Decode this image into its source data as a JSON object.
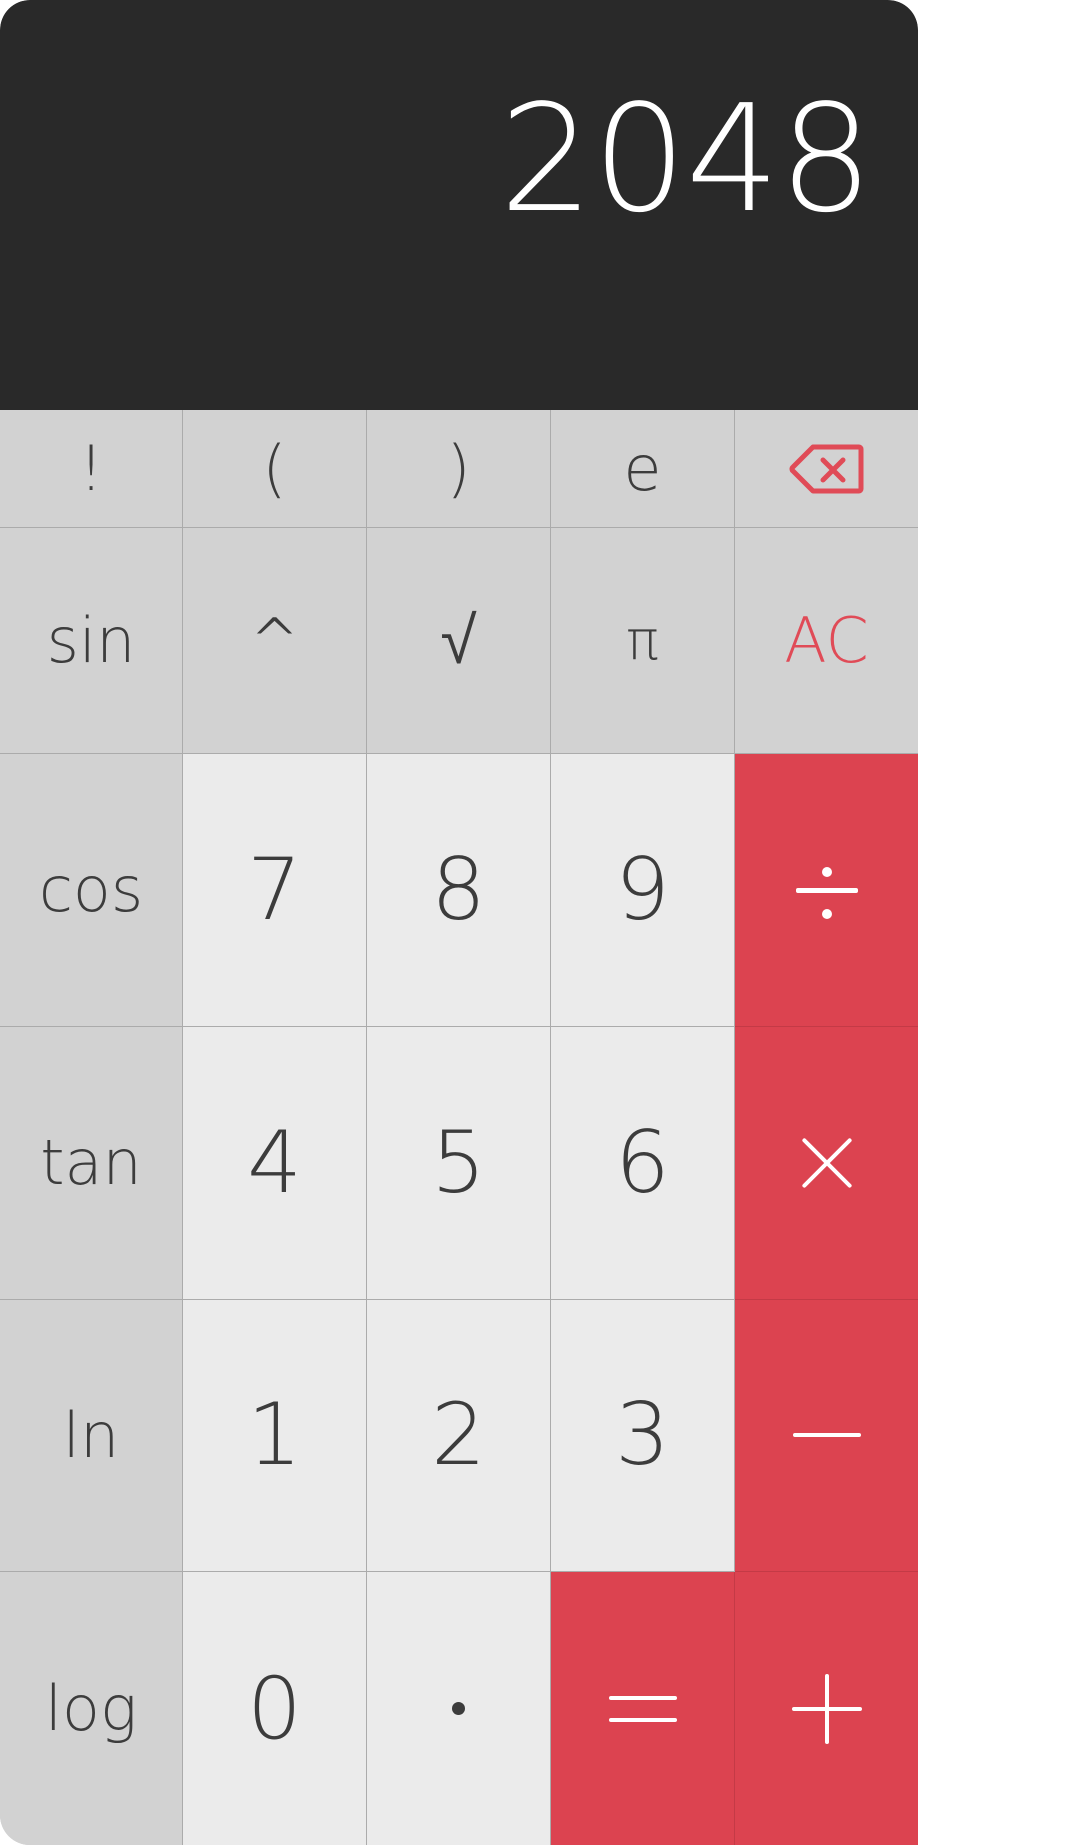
{
  "app": {
    "title": "Calculator",
    "accent_red": "#dc4350",
    "accent_red_text": "#e04b57",
    "display_bg": "#292929",
    "function_key_bg": "#d2d2d2",
    "number_key_bg": "#ebebeb",
    "key_text": "#3c3c3c",
    "divider": "#ababab"
  },
  "display": {
    "value": "2048",
    "align": "right"
  },
  "keypad": {
    "row1": [
      {
        "label": "!",
        "name": "factorial-button"
      },
      {
        "label": "(",
        "name": "open-paren-button"
      },
      {
        "label": ")",
        "name": "close-paren-button"
      },
      {
        "label": "e",
        "name": "euler-button"
      },
      {
        "label": "",
        "name": "backspace-button",
        "icon": "backspace-icon"
      }
    ],
    "row2": [
      {
        "label": "sin",
        "name": "sin-button"
      },
      {
        "label": "^",
        "name": "power-button"
      },
      {
        "label": "√",
        "name": "sqrt-button"
      },
      {
        "label": "π",
        "name": "pi-button"
      },
      {
        "label": "AC",
        "name": "all-clear-button"
      }
    ],
    "row3": [
      {
        "label": "cos",
        "name": "cos-button"
      },
      {
        "label": "7",
        "name": "digit-7-button"
      },
      {
        "label": "8",
        "name": "digit-8-button"
      },
      {
        "label": "9",
        "name": "digit-9-button"
      },
      {
        "label": "÷",
        "name": "divide-button",
        "icon": "divide-icon"
      }
    ],
    "row4": [
      {
        "label": "tan",
        "name": "tan-button"
      },
      {
        "label": "4",
        "name": "digit-4-button"
      },
      {
        "label": "5",
        "name": "digit-5-button"
      },
      {
        "label": "6",
        "name": "digit-6-button"
      },
      {
        "label": "×",
        "name": "multiply-button",
        "icon": "multiply-icon"
      }
    ],
    "row5": [
      {
        "label": "ln",
        "name": "ln-button"
      },
      {
        "label": "1",
        "name": "digit-1-button"
      },
      {
        "label": "2",
        "name": "digit-2-button"
      },
      {
        "label": "3",
        "name": "digit-3-button"
      },
      {
        "label": "−",
        "name": "subtract-button",
        "icon": "minus-icon"
      }
    ],
    "row6": [
      {
        "label": "log",
        "name": "log-button"
      },
      {
        "label": "0",
        "name": "digit-0-button"
      },
      {
        "label": "·",
        "name": "decimal-point-button",
        "icon": "dot-icon"
      },
      {
        "label": "=",
        "name": "equals-button",
        "icon": "equals-icon"
      },
      {
        "label": "+",
        "name": "add-button",
        "icon": "plus-icon"
      }
    ]
  }
}
